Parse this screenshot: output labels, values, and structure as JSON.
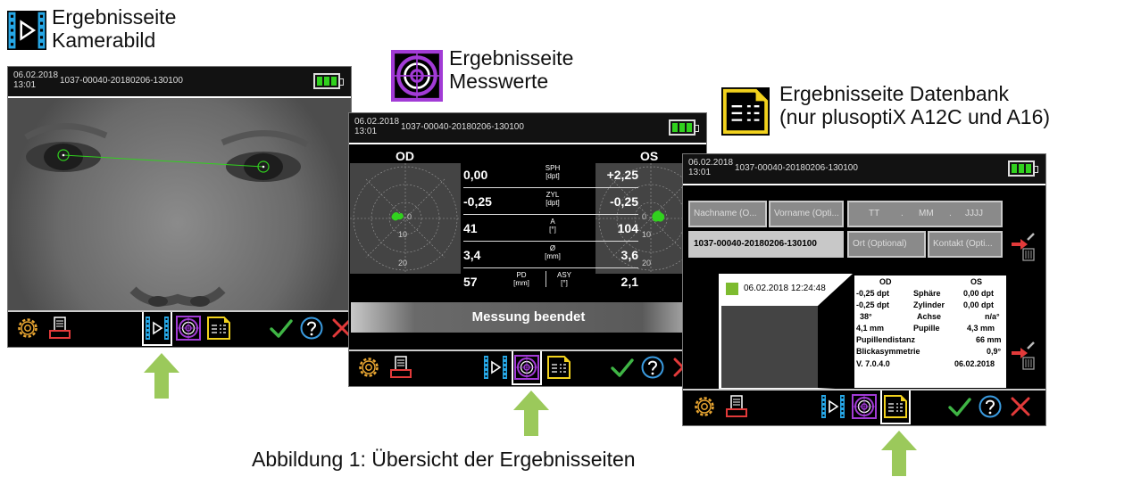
{
  "labels": {
    "camera_line1": "Ergebnisseite",
    "camera_line2": "Kamerabild",
    "measure_line1": "Ergebnisseite",
    "measure_line2": "Messwerte",
    "db_line1": "Ergebnisseite Datenbank",
    "db_line2": "(nur plusoptiX A12C und A16)"
  },
  "caption": "Abbildung 1: Übersicht der Ergebnisseiten",
  "header": {
    "date": "06.02.2018",
    "time": "13:01",
    "measurement_id": "1037-00040-20180206-130100"
  },
  "measure": {
    "od_label": "OD",
    "os_label": "OS",
    "polar_ticks": [
      "0",
      "10",
      "20"
    ],
    "rows": [
      {
        "left": "0,00",
        "label": "SPH",
        "unit": "[dpt]",
        "right": "+2,25"
      },
      {
        "left": "-0,25",
        "label": "ZYL",
        "unit": "[dpt]",
        "right": "-0,25"
      },
      {
        "left": "41",
        "label": "A",
        "unit": "[°]",
        "right": "104"
      },
      {
        "left": "3,4",
        "label": "Ø",
        "unit": "[mm]",
        "right": "3,6"
      },
      {
        "left": "57",
        "label": "PD",
        "unit": "[mm]",
        "label2": "ASY",
        "unit2": "[°]",
        "right": "2,1"
      }
    ],
    "status": "Messung beendet"
  },
  "database": {
    "fields": {
      "nachname": "Nachname (O...",
      "vorname": "Vorname (Opti...",
      "tt": "TT",
      "mm": "MM",
      "jjjj": "JJJJ",
      "date_sep": ".",
      "id": "1037-00040-20180206-130100",
      "ort": "Ort (Optional)",
      "kontakt": "Kontakt (Opti..."
    },
    "record_datetime": "06.02.2018 12:24:48",
    "report": {
      "od": "OD",
      "os": "OS",
      "sph_od": "-0,25 dpt",
      "sph_label": "Sphäre",
      "sph_os": "0,00 dpt",
      "zyl_od": "-0,25 dpt",
      "zyl_label": "Zylinder",
      "zyl_os": "0,00 dpt",
      "achse_od": "38°",
      "achse_label": "Achse",
      "achse_os": "n/a°",
      "pup_od": "4,1 mm",
      "pup_label": "Pupille",
      "pup_os": "4,3 mm",
      "pd_label": "Pupillendistanz",
      "pd_value": "66 mm",
      "asy_label": "Blickasymmetrie",
      "asy_value": "0,9°",
      "version": "V. 7.0.4.0",
      "report_date": "06.02.2018"
    }
  },
  "colors": {
    "battery": "#31d11e",
    "accent_blue": "#26a7e6",
    "accent_purple": "#a23bd6",
    "accent_yellow": "#f2d21d",
    "settings_orange": "#e8a531",
    "check_green": "#3fb545",
    "close_red": "#e23a3a",
    "help_blue": "#3a9be0",
    "pointer_arrow": "#9bc95b"
  },
  "icons": [
    "camera-page-icon",
    "measurement-page-icon",
    "database-page-icon",
    "settings-icon",
    "print-icon",
    "confirm-icon",
    "help-icon",
    "close-icon",
    "delete-icon"
  ]
}
